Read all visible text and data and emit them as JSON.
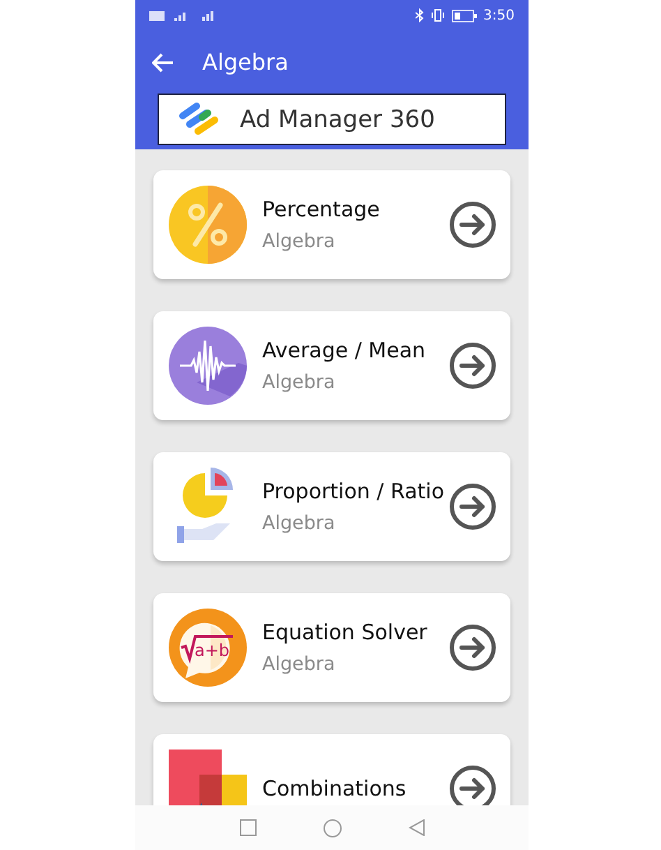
{
  "status_bar": {
    "time": "3:50"
  },
  "app_bar": {
    "title": "Algebra"
  },
  "ad_banner": {
    "text": "Ad Manager 360"
  },
  "items": [
    {
      "kind": "percent",
      "title": "Percentage",
      "subtitle": "Algebra"
    },
    {
      "kind": "wave",
      "title": "Average / Mean",
      "subtitle": "Algebra"
    },
    {
      "kind": "pie",
      "title": "Proportion / Ratio",
      "subtitle": "Algebra"
    },
    {
      "kind": "equation",
      "title": "Equation Solver",
      "subtitle": "Algebra",
      "icon_text": "a+b"
    },
    {
      "kind": "squares",
      "title": "Combinations"
    }
  ]
}
